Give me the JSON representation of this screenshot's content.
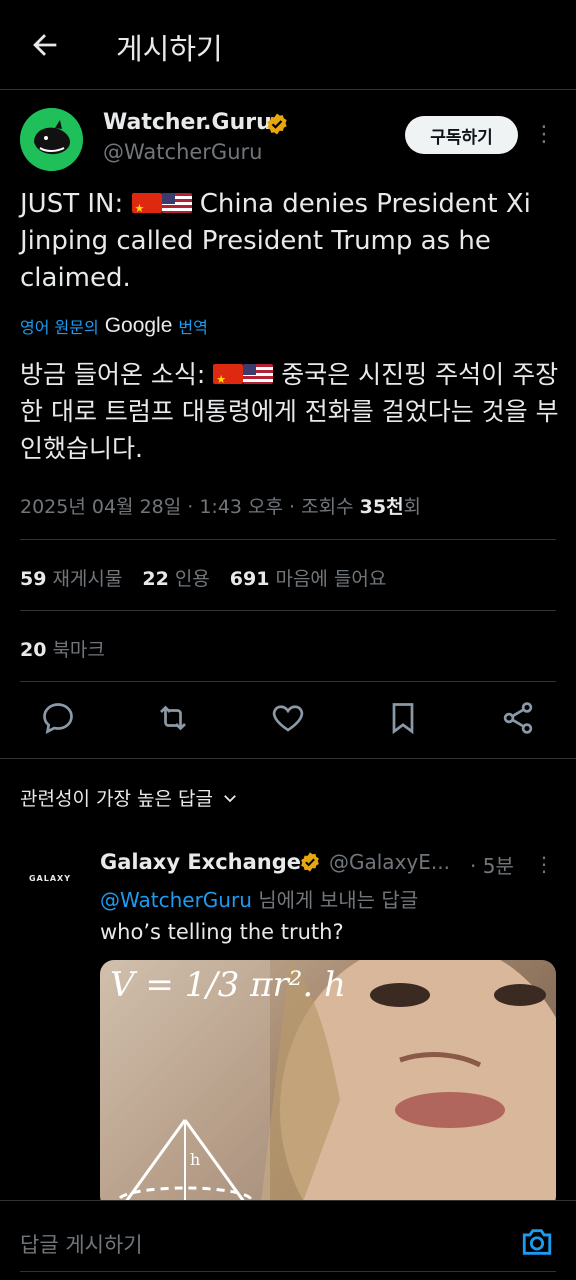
{
  "topbar": {
    "title": "게시하기"
  },
  "author": {
    "name": "Watcher.Guru",
    "handle": "@WatcherGuru",
    "subscribe_label": "구독하기"
  },
  "tweet": {
    "text_prefix": "JUST IN:",
    "text_body": "China denies President Xi Jinping called President Trump as he claimed.",
    "translate": {
      "prefix": "영어 원문의",
      "google": "Google",
      "suffix": "번역"
    },
    "translated_prefix": "방금 들어온 소식:",
    "translated_body": "중국은 시진핑 주석이 주장한 대로 트럼프 대통령에게 전화를 걸었다는 것을 부인했습니다.",
    "meta_date": "2025년 04월 28일 · 1:43 오후 · 조회수",
    "meta_views": "35천",
    "meta_views_suffix": "회"
  },
  "stats": {
    "reposts_count": "59",
    "reposts_label": "재게시물",
    "quotes_count": "22",
    "quotes_label": "인용",
    "likes_count": "691",
    "likes_label": "마음에 들어요",
    "bookmarks_count": "20",
    "bookmarks_label": "북마크"
  },
  "sort": {
    "label": "관련성이 가장 높은 답글"
  },
  "reply": {
    "avatar_text": "GALAXY",
    "name": "Galaxy Exchange",
    "handle": "@GalaxyE...",
    "time": "· 5분",
    "mention": "@WatcherGuru",
    "replying_suffix": "님에게 보내는 답글",
    "text": "who’s telling the truth?",
    "media_formula": "V = 1/3 πr². h",
    "media_h": "h"
  },
  "composer": {
    "placeholder": "답글 게시하기"
  },
  "colors": {
    "accent": "#1d9bf0",
    "verified": "#e7a80f",
    "background": "#000000",
    "muted": "#71767b"
  },
  "icons": [
    "back-arrow-icon",
    "verified-badge-icon",
    "more-icon",
    "reply-icon",
    "repost-icon",
    "like-icon",
    "bookmark-icon",
    "share-icon",
    "chevron-down-icon",
    "camera-icon"
  ]
}
